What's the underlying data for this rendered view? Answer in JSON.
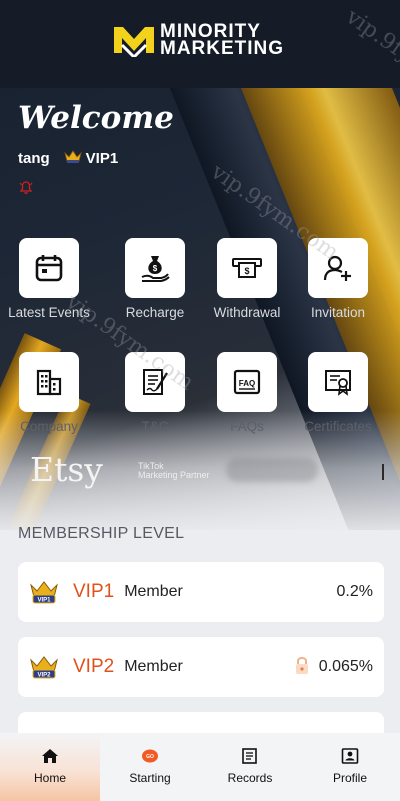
{
  "brand": {
    "name_line1": "MINORITY",
    "name_line2": "MARKETING",
    "accent": "#f2d21b"
  },
  "welcome": "Welcome",
  "user": {
    "name": "tang",
    "vip": "VIP1"
  },
  "actions": [
    {
      "label": "Latest Events",
      "icon": "calendar-icon"
    },
    {
      "label": "Recharge",
      "icon": "money-bag-icon"
    },
    {
      "label": "Withdrawal",
      "icon": "cash-withdraw-icon"
    },
    {
      "label": "Invitation",
      "icon": "add-user-icon"
    },
    {
      "label": "Company",
      "icon": "buildings-icon"
    },
    {
      "label": "T&C",
      "icon": "contract-icon"
    },
    {
      "label": "FAQs",
      "icon": "faq-icon"
    },
    {
      "label": "Certificates",
      "icon": "certificate-icon"
    }
  ],
  "brands": {
    "etsy": "Etsy",
    "tiktok_line1": "TikTok",
    "tiktok_line2": "Marketing Partner"
  },
  "membership": {
    "title": "MEMBERSHIP LEVEL",
    "levels": [
      {
        "name": "VIP1",
        "role": "Member",
        "rate": "0.2%",
        "locked": false
      },
      {
        "name": "VIP2",
        "role": "Member",
        "rate": "0.065%",
        "locked": true
      }
    ]
  },
  "watermark": "vip.9fym.com",
  "nav": [
    {
      "label": "Home",
      "icon": "home-icon",
      "active": true
    },
    {
      "label": "Starting",
      "icon": "starting-icon",
      "active": false
    },
    {
      "label": "Records",
      "icon": "records-icon",
      "active": false
    },
    {
      "label": "Profile",
      "icon": "profile-icon",
      "active": false
    }
  ],
  "colors": {
    "vip_name": "#e0521b",
    "gold": "#e9b01c",
    "header_bg": "#151c27"
  }
}
